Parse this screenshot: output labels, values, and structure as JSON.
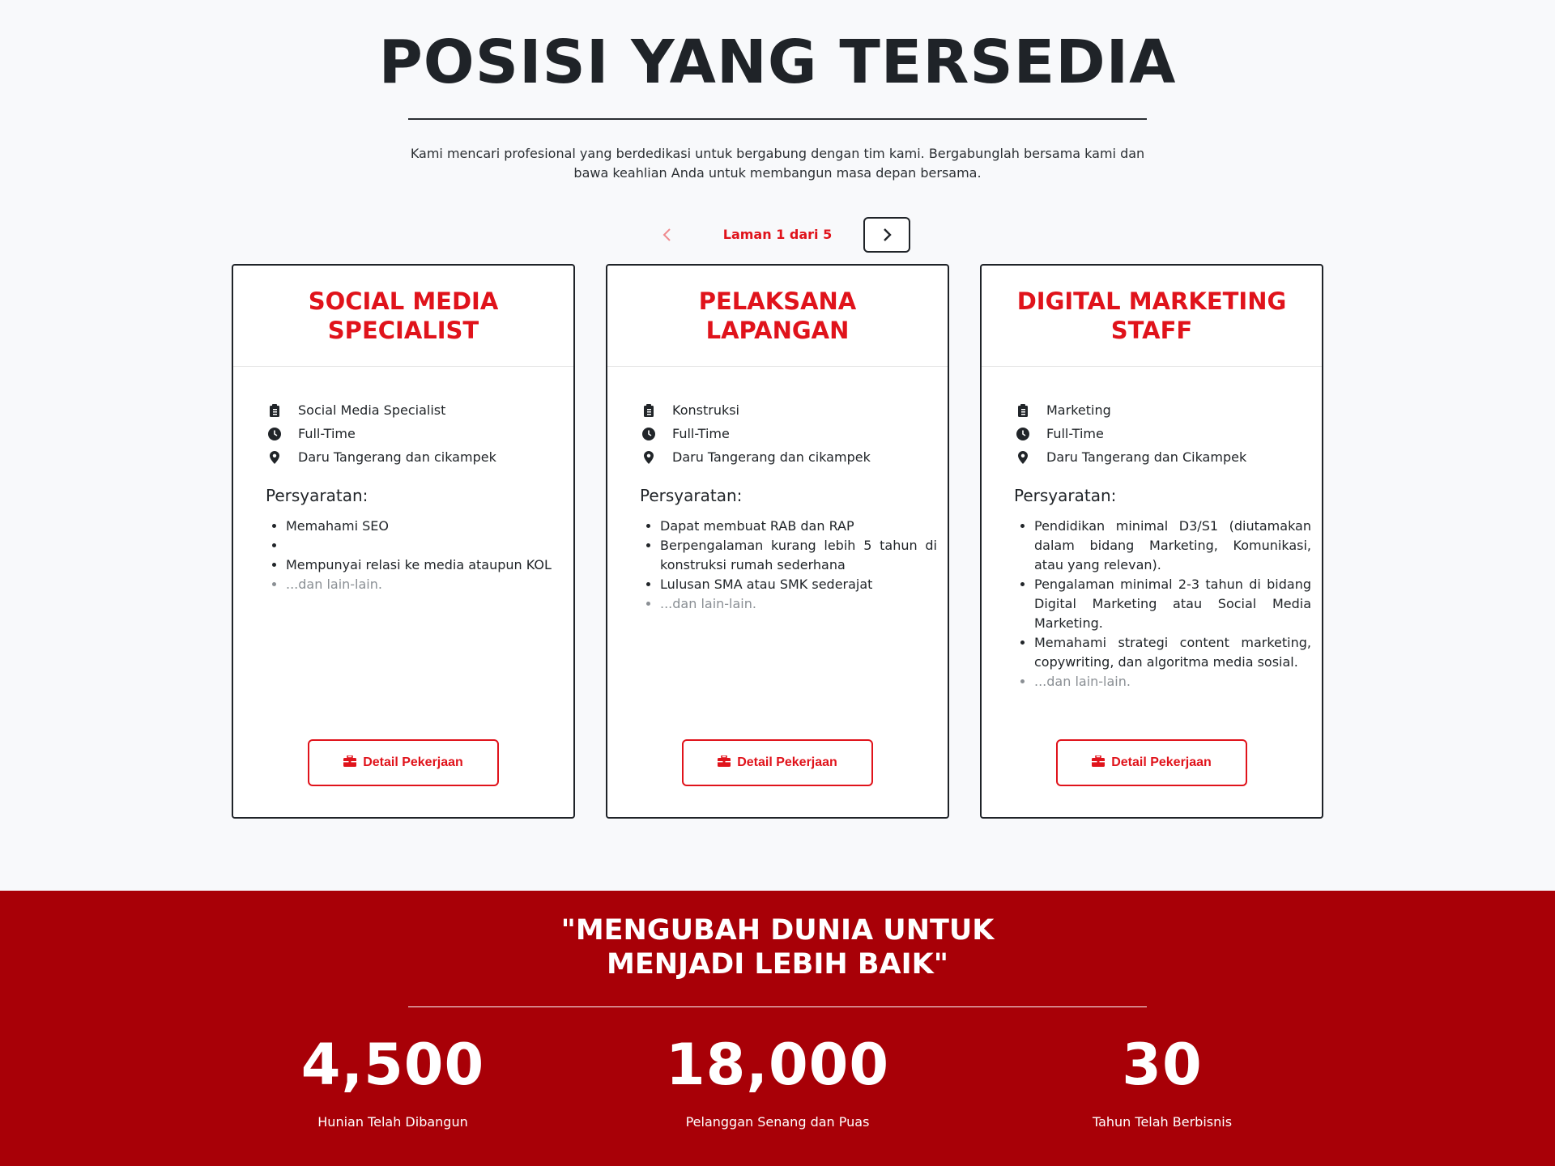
{
  "heading": {
    "title": "POSISI YANG TERSEDIA",
    "intro": "Kami mencari profesional yang berdedikasi untuk bergabung dengan tim kami. Bergabunglah bersama kami dan bawa keahlian Anda untuk membangun masa depan bersama."
  },
  "pager": {
    "label": "Laman 1 dari 5",
    "prev_icon": "chevron-left-icon",
    "next_icon": "chevron-right-icon"
  },
  "colors": {
    "accent": "#e0131b",
    "band": "#a80007",
    "text": "#212529"
  },
  "jobs": [
    {
      "title": "SOCIAL MEDIA SPECIALIST",
      "category": "Social Media Specialist",
      "type": "Full-Time",
      "location": "Daru Tangerang dan cikampek",
      "requirements_title": "Persyaratan:",
      "requirements": [
        "Memahami SEO",
        "",
        "Mempunyai relasi ke media ataupun KOL"
      ],
      "more": "...dan lain-lain.",
      "button": "Detail Pekerjaan"
    },
    {
      "title": "PELAKSANA LAPANGAN",
      "category": "Konstruksi",
      "type": "Full-Time",
      "location": "Daru Tangerang dan cikampek",
      "requirements_title": "Persyaratan:",
      "requirements": [
        "Dapat membuat RAB dan RAP",
        "Berpengalaman kurang lebih 5 tahun di konstruksi rumah sederhana",
        "Lulusan SMA atau SMK sederajat"
      ],
      "more": "...dan lain-lain.",
      "button": "Detail Pekerjaan"
    },
    {
      "title": "DIGITAL MARKETING STAFF",
      "category": "Marketing",
      "type": "Full-Time",
      "location": "Daru Tangerang dan Cikampek",
      "requirements_title": "Persyaratan:",
      "requirements": [
        "Pendidikan minimal D3/S1 (diutamakan dalam bidang Marketing, Komunikasi, atau yang relevan).",
        "Pengalaman minimal 2-3 tahun di bidang Digital Marketing atau Social Media Marketing.",
        "Memahami strategi content marketing, copywriting, dan algoritma media sosial."
      ],
      "more": "...dan lain-lain.",
      "button": "Detail Pekerjaan"
    }
  ],
  "band": {
    "quote": "\"MENGUBAH DUNIA UNTUK MENJADI LEBIH BAIK\"",
    "stats": [
      {
        "value": "4,500",
        "label": "Hunian Telah Dibangun"
      },
      {
        "value": "18,000",
        "label": "Pelanggan Senang dan Puas"
      },
      {
        "value": "30",
        "label": "Tahun Telah Berbisnis"
      }
    ]
  }
}
